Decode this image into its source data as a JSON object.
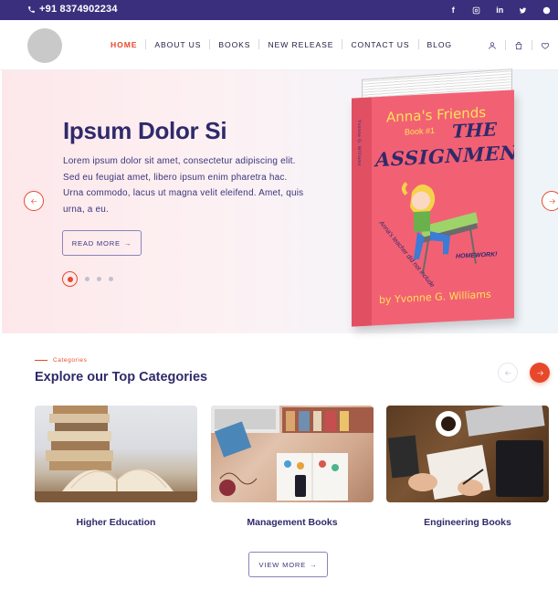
{
  "topbar": {
    "phone": "+91 8374902234",
    "socials": [
      "f",
      "instagram-icon",
      "in",
      "twitter-icon",
      "skype-icon"
    ]
  },
  "nav": {
    "items": [
      {
        "label": "HOME",
        "active": true
      },
      {
        "label": "ABOUT US",
        "active": false
      },
      {
        "label": "BOOKS",
        "active": false
      },
      {
        "label": "NEW RELEASE",
        "active": false
      },
      {
        "label": "CONTACT US",
        "active": false
      },
      {
        "label": "BLOG",
        "active": false
      }
    ],
    "icons": [
      "user-icon",
      "bag-icon",
      "heart-icon"
    ]
  },
  "hero": {
    "title": "Ipsum Dolor Si",
    "text": "Lorem ipsum dolor sit amet, consectetur adipiscing elit. Sed eu feugiat amet, libero ipsum enim pharetra hac. Urna commodo, lacus ut magna velit eleifend. Amet, quis urna, a eu.",
    "button": "READ MORE",
    "arrow_glyph": "→",
    "slides": 4,
    "active_slide": 1,
    "book": {
      "series": "Anna's Friends",
      "number": "Book #1",
      "title_line1": "THE",
      "title_line2": "ASSIGNMENT",
      "tagline_1": "Anna's teacher did not include",
      "tagline_2": "HOMEWORK!",
      "author": "by Yvonne G. Williams",
      "spine": "Yvonne G. Williams"
    }
  },
  "categories": {
    "kicker": "Categories",
    "title": "Explore our Top Categories",
    "items": [
      {
        "label": "Higher Education"
      },
      {
        "label": "Management Books"
      },
      {
        "label": "Engineering Books"
      }
    ],
    "view_more": "VIEW MORE"
  },
  "colors": {
    "brand": "#3a2f7d",
    "accent": "#e8482a"
  }
}
